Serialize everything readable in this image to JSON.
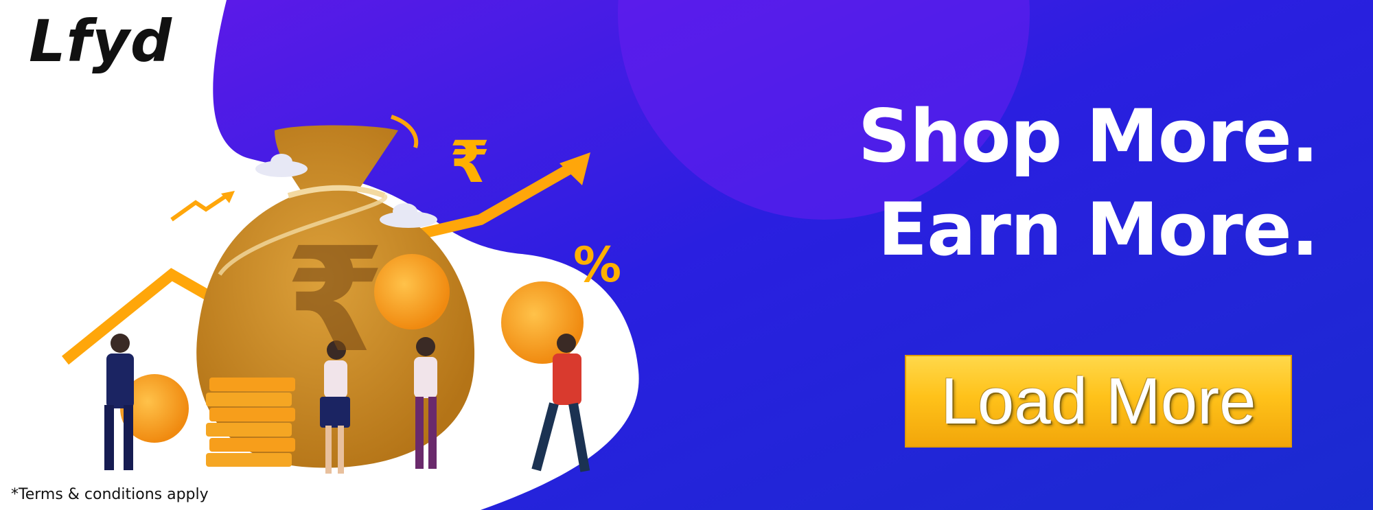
{
  "brand": {
    "logo_text": "Lfyd"
  },
  "headline": {
    "line1": "Shop More.",
    "line2": "Earn More."
  },
  "cta": {
    "label": "Load More"
  },
  "footer": {
    "terms": "*Terms & conditions apply"
  },
  "illustration": {
    "currency_symbol": "₹",
    "percent_symbol": "%"
  },
  "colors": {
    "background_blue": "#1f25d6",
    "background_purple": "#5a18e8",
    "cta_yellow": "#ffc21a",
    "arrow_orange": "#ffb000",
    "money_bag": "#c98a1e",
    "coin": "#f7a21b"
  }
}
